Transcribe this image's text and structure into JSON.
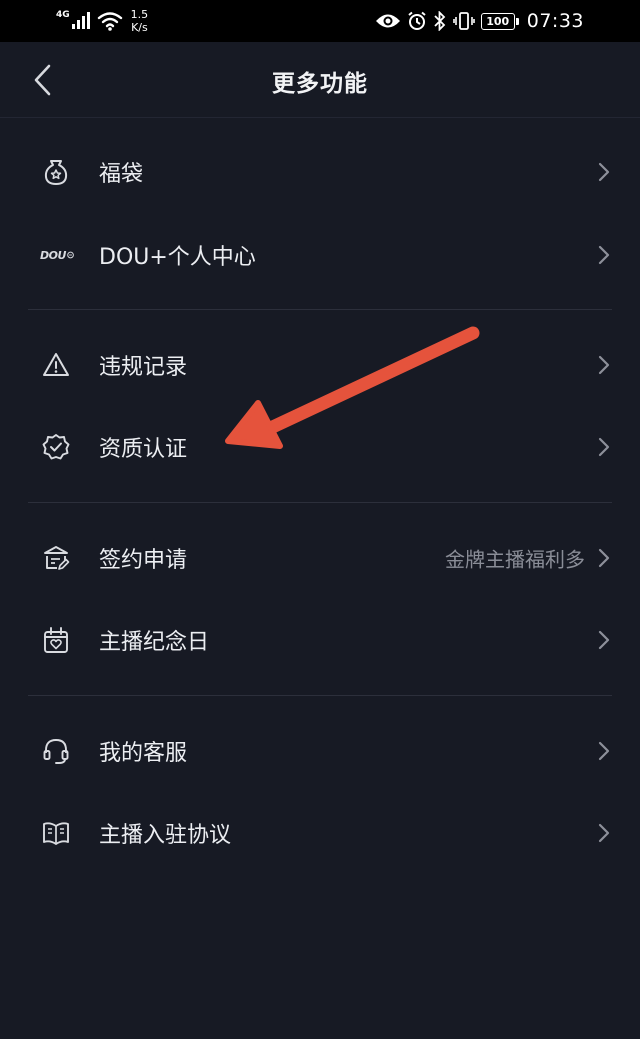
{
  "status_bar": {
    "network": "4G",
    "speed_value": "1.5",
    "speed_unit": "K/s",
    "battery": "100",
    "time": "07:33"
  },
  "header": {
    "title": "更多功能"
  },
  "groups": [
    {
      "items": [
        {
          "label": "福袋",
          "icon": "lucky-bag-icon"
        },
        {
          "label": "DOU+个人中心",
          "icon": "dou-plus-icon",
          "icon_text": "DOU"
        }
      ]
    },
    {
      "items": [
        {
          "label": "违规记录",
          "icon": "warning-icon"
        },
        {
          "label": "资质认证",
          "icon": "verified-badge-icon"
        }
      ]
    },
    {
      "items": [
        {
          "label": "签约申请",
          "icon": "contract-icon",
          "subtitle": "金牌主播福利多"
        },
        {
          "label": "主播纪念日",
          "icon": "anniversary-calendar-icon"
        }
      ]
    },
    {
      "items": [
        {
          "label": "我的客服",
          "icon": "headset-icon"
        },
        {
          "label": "主播入驻协议",
          "icon": "book-icon"
        }
      ]
    }
  ],
  "colors": {
    "background": "#171a24",
    "status_bar": "#000000",
    "annotation_arrow": "#e5533c",
    "subtitle_text": "#8a8d97"
  }
}
